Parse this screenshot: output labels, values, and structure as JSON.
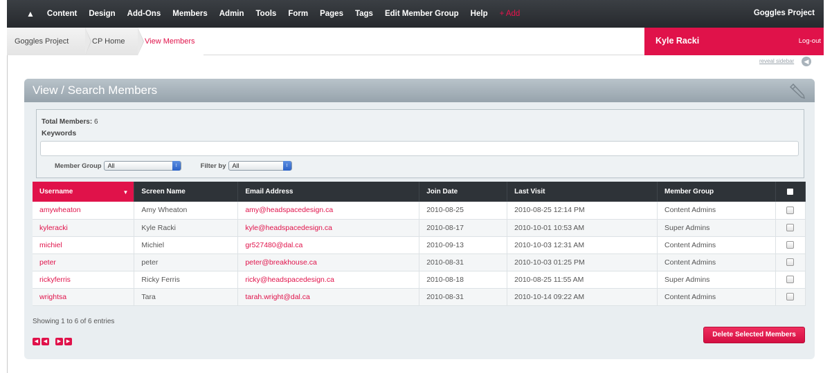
{
  "nav": {
    "items": [
      "Content",
      "Design",
      "Add-Ons",
      "Members",
      "Admin",
      "Tools",
      "Form",
      "Pages",
      "Tags",
      "Edit Member Group",
      "Help"
    ],
    "add_label": "+ Add",
    "site_name": "Goggles Project"
  },
  "breadcrumb": {
    "items": [
      "Goggles Project",
      "CP Home",
      "View Members"
    ]
  },
  "user": {
    "name": "Kyle Racki",
    "logout": "Log-out"
  },
  "sidebar_toggle": "reveal sidebar",
  "panel": {
    "title": "View / Search Members"
  },
  "search": {
    "total_label": "Total Members:",
    "total_value": "6",
    "keywords_label": "Keywords",
    "keywords_value": "",
    "member_group_label": "Member Group",
    "member_group_value": "All",
    "filter_by_label": "Filter by",
    "filter_by_value": "All"
  },
  "table": {
    "columns": [
      "Username",
      "Screen Name",
      "Email Address",
      "Join Date",
      "Last Visit",
      "Member Group"
    ],
    "rows": [
      {
        "username": "amywheaton",
        "screen_name": "Amy Wheaton",
        "email": "amy@headspacedesign.ca",
        "join_date": "2010-08-25",
        "last_visit": "2010-08-25 12:14 PM",
        "group": "Content Admins"
      },
      {
        "username": "kyleracki",
        "screen_name": "Kyle Racki",
        "email": "kyle@headspacedesign.ca",
        "join_date": "2010-08-17",
        "last_visit": "2010-10-01 10:53 AM",
        "group": "Super Admins"
      },
      {
        "username": "michiel",
        "screen_name": "Michiel",
        "email": "gr527480@dal.ca",
        "join_date": "2010-09-13",
        "last_visit": "2010-10-03 12:31 AM",
        "group": "Content Admins"
      },
      {
        "username": "peter",
        "screen_name": "peter",
        "email": "peter@breakhouse.ca",
        "join_date": "2010-08-31",
        "last_visit": "2010-10-03 01:25 PM",
        "group": "Content Admins"
      },
      {
        "username": "rickyferris",
        "screen_name": "Ricky Ferris",
        "email": "ricky@headspacedesign.ca",
        "join_date": "2010-08-18",
        "last_visit": "2010-08-25 11:55 AM",
        "group": "Super Admins"
      },
      {
        "username": "wrightsa",
        "screen_name": "Tara",
        "email": "tarah.wright@dal.ca",
        "join_date": "2010-08-31",
        "last_visit": "2010-10-14 09:22 AM",
        "group": "Content Admins"
      }
    ]
  },
  "footer": {
    "showing": "Showing 1 to 6 of 6 entries",
    "delete_button": "Delete Selected Members"
  },
  "colors": {
    "accent": "#e0124a",
    "nav_bg": "#2e3338",
    "panel_header": "#a7b2ba"
  }
}
